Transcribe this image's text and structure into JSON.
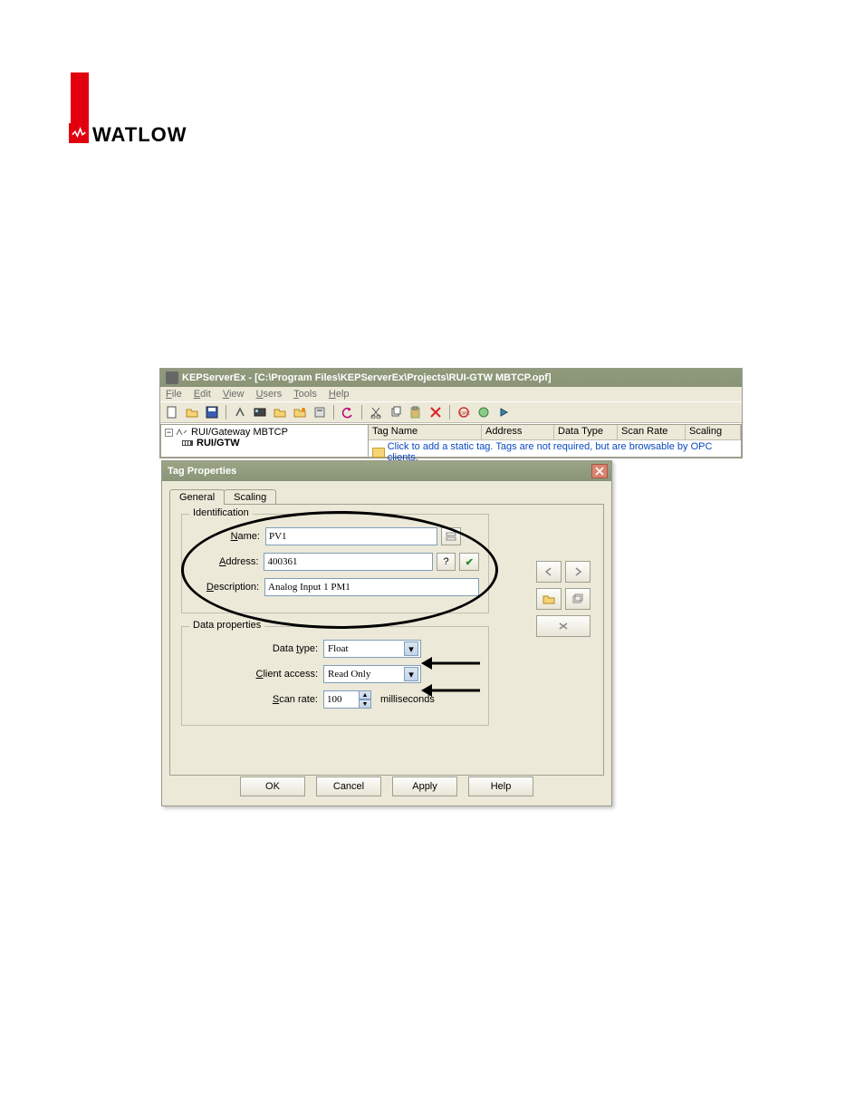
{
  "logo": {
    "text": "WATLOW"
  },
  "app": {
    "title": "KEPServerEx - [C:\\Program Files\\KEPServerEx\\Projects\\RUI-GTW MBTCP.opf]",
    "menu": {
      "file": "File",
      "edit": "Edit",
      "view": "View",
      "users": "Users",
      "tools": "Tools",
      "help": "Help"
    },
    "tree": {
      "channel": "RUI/Gateway MBTCP",
      "device": "RUI/GTW"
    },
    "grid": {
      "cols": {
        "tag": "Tag Name",
        "addr": "Address",
        "dtype": "Data Type",
        "scan": "Scan Rate",
        "scal": "Scaling"
      },
      "hint": "Click to add a static tag.  Tags are not required, but are browsable by OPC clients."
    }
  },
  "dialog": {
    "title": "Tag Properties",
    "tabs": {
      "general": "General",
      "scaling": "Scaling"
    },
    "identification": {
      "title": "Identification",
      "name_label": "Name:",
      "name_value": "PV1",
      "addr_label": "Address:",
      "addr_value": "400361",
      "addr_help": "?",
      "desc_label": "Description:",
      "desc_value": "Analog Input 1 PM1"
    },
    "data": {
      "title": "Data properties",
      "dtype_label": "Data type:",
      "dtype_value": "Float",
      "access_label": "Client access:",
      "access_value": "Read Only",
      "scan_label": "Scan rate:",
      "scan_value": "100",
      "scan_unit": "milliseconds"
    },
    "buttons": {
      "ok": "OK",
      "cancel": "Cancel",
      "apply": "Apply",
      "help": "Help"
    }
  }
}
